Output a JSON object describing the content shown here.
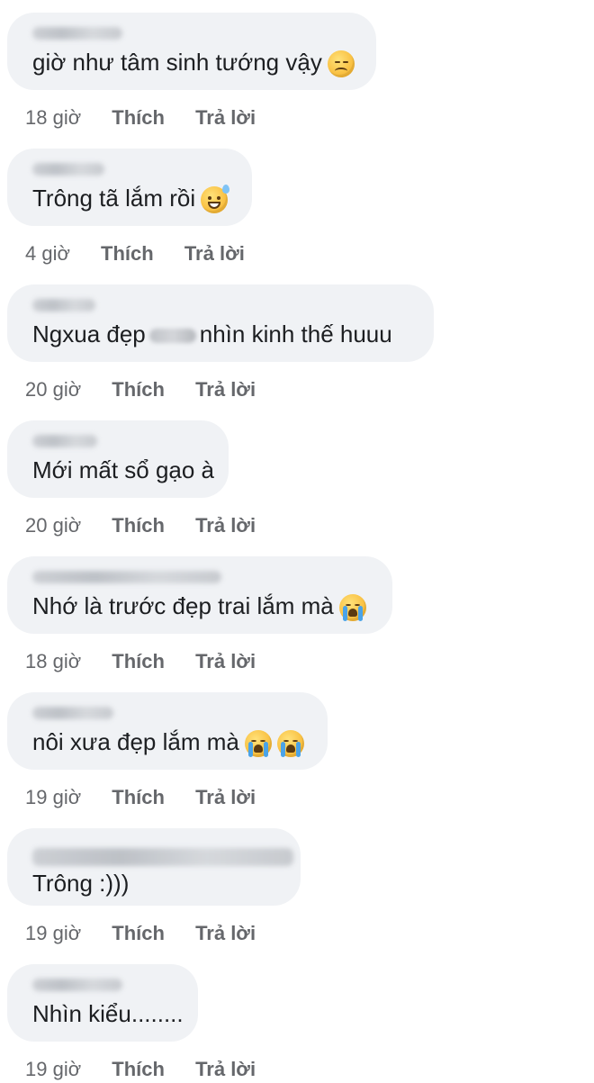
{
  "labels": {
    "like": "Thích",
    "reply": "Trả lời"
  },
  "comments": [
    {
      "text": "giờ như tâm sinh tướng vậy",
      "time": "18 giờ",
      "emoji": [
        "disappointed-face-emoji"
      ]
    },
    {
      "text": "Trông tã lắm rồi",
      "time": "4 giờ",
      "emoji": [
        "grinning-sweat-face-emoji"
      ]
    },
    {
      "text_a": "Ngxua đẹp",
      "text_b": "nhìn kinh thế huuu",
      "time": "20 giờ",
      "emoji": []
    },
    {
      "text": "Mới mất sổ gạo à",
      "time": "20 giờ",
      "emoji": []
    },
    {
      "text": "Nhớ là trước đẹp trai lắm mà",
      "time": "18 giờ",
      "emoji": [
        "loudly-crying-face-emoji"
      ]
    },
    {
      "text": "nôi xưa đẹp lắm mà",
      "time": "19 giờ",
      "emoji": [
        "loudly-crying-face-emoji",
        "loudly-crying-face-emoji"
      ]
    },
    {
      "text": "Trông :)))",
      "time": "19 giờ",
      "emoji": []
    },
    {
      "text": "Nhìn kiểu........",
      "time": "19 giờ",
      "emoji": []
    }
  ]
}
